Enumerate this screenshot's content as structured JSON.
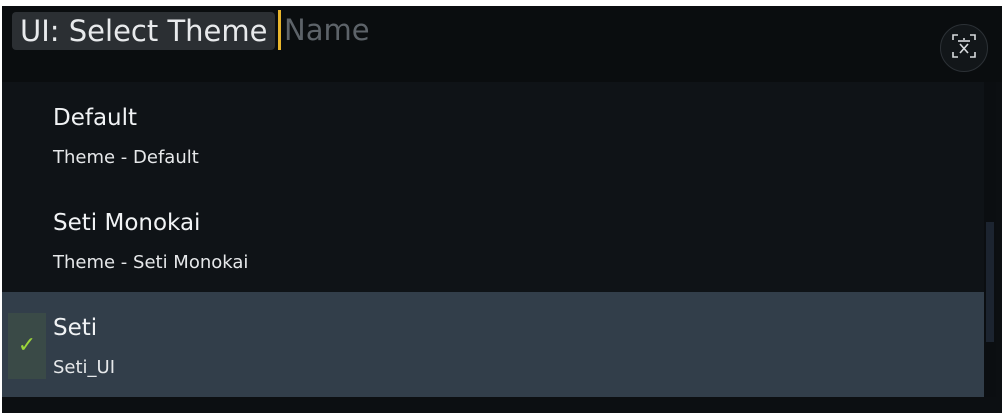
{
  "palette": {
    "prompt_bg": "#2b2f33",
    "caret": "#e8b52c",
    "list_bg": "#0f1317",
    "selected_bg": "#323e4a",
    "check": "#9cd63a"
  },
  "header": {
    "prompt_label": "UI: Select Theme",
    "input_placeholder": "Name",
    "translate_icon": "translate-icon"
  },
  "themes": [
    {
      "title": "Default",
      "subtitle": "Theme - Default",
      "selected": false
    },
    {
      "title": "Seti Monokai",
      "subtitle": "Theme - Seti Monokai",
      "selected": false
    },
    {
      "title": "Seti",
      "subtitle": "Seti_UI",
      "selected": true,
      "check_glyph": "✓"
    }
  ]
}
